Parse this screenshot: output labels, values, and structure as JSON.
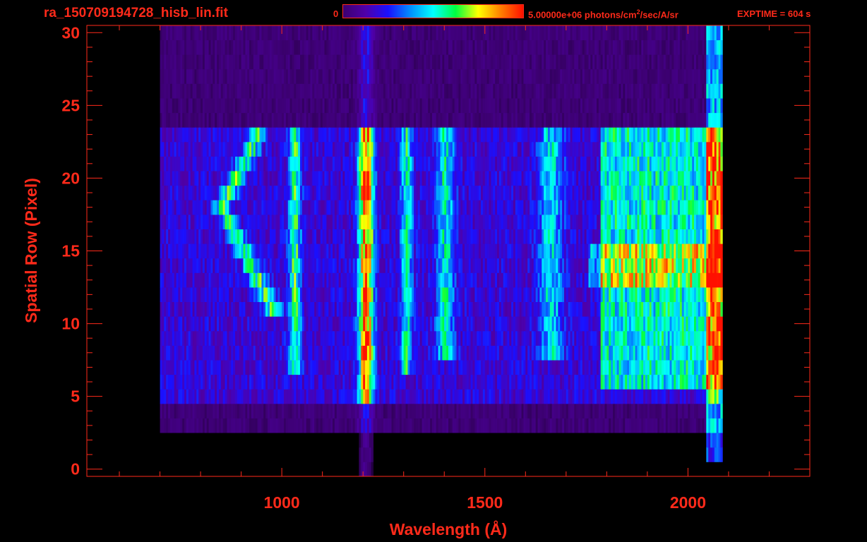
{
  "header": {
    "title": "ra_150709194728_hisb_lin.fit",
    "colorbar_min": "0",
    "colorbar_max": "5.00000e+06 photons/cm",
    "colorbar_max_sup": "2",
    "colorbar_max_rest": "/sec/A/sr",
    "exptime": "EXPTIME = 604 s"
  },
  "colors": {
    "text": "#ff2a1a",
    "axes": "#ff2a1a",
    "background": "#000000",
    "colormap": [
      "#000000",
      "#3c0070",
      "#4f00a8",
      "#1a10ff",
      "#0090ff",
      "#00ffff",
      "#00ff40",
      "#ffff00",
      "#ff8000",
      "#ff1000"
    ]
  },
  "chart_data": {
    "type": "heatmap",
    "title": "ra_150709194728_hisb_lin.fit",
    "xlabel": "Wavelength (Å)",
    "ylabel": "Spatial Row (Pixel)",
    "xlim": [
      520,
      2300
    ],
    "ylim": [
      -0.5,
      30.5
    ],
    "xticks": [
      1000,
      1500,
      2000
    ],
    "xtick_labels": [
      "1000",
      "1500",
      "2000"
    ],
    "yticks": [
      0,
      5,
      10,
      15,
      20,
      25,
      30
    ],
    "ytick_labels": [
      "0",
      "5",
      "10",
      "15",
      "20",
      "25",
      "30"
    ],
    "colorbar": {
      "min": 0,
      "max": 5000000,
      "units": "photons/cm^2/sec/A/sr"
    },
    "exptime_s": 604,
    "grid": false
  }
}
